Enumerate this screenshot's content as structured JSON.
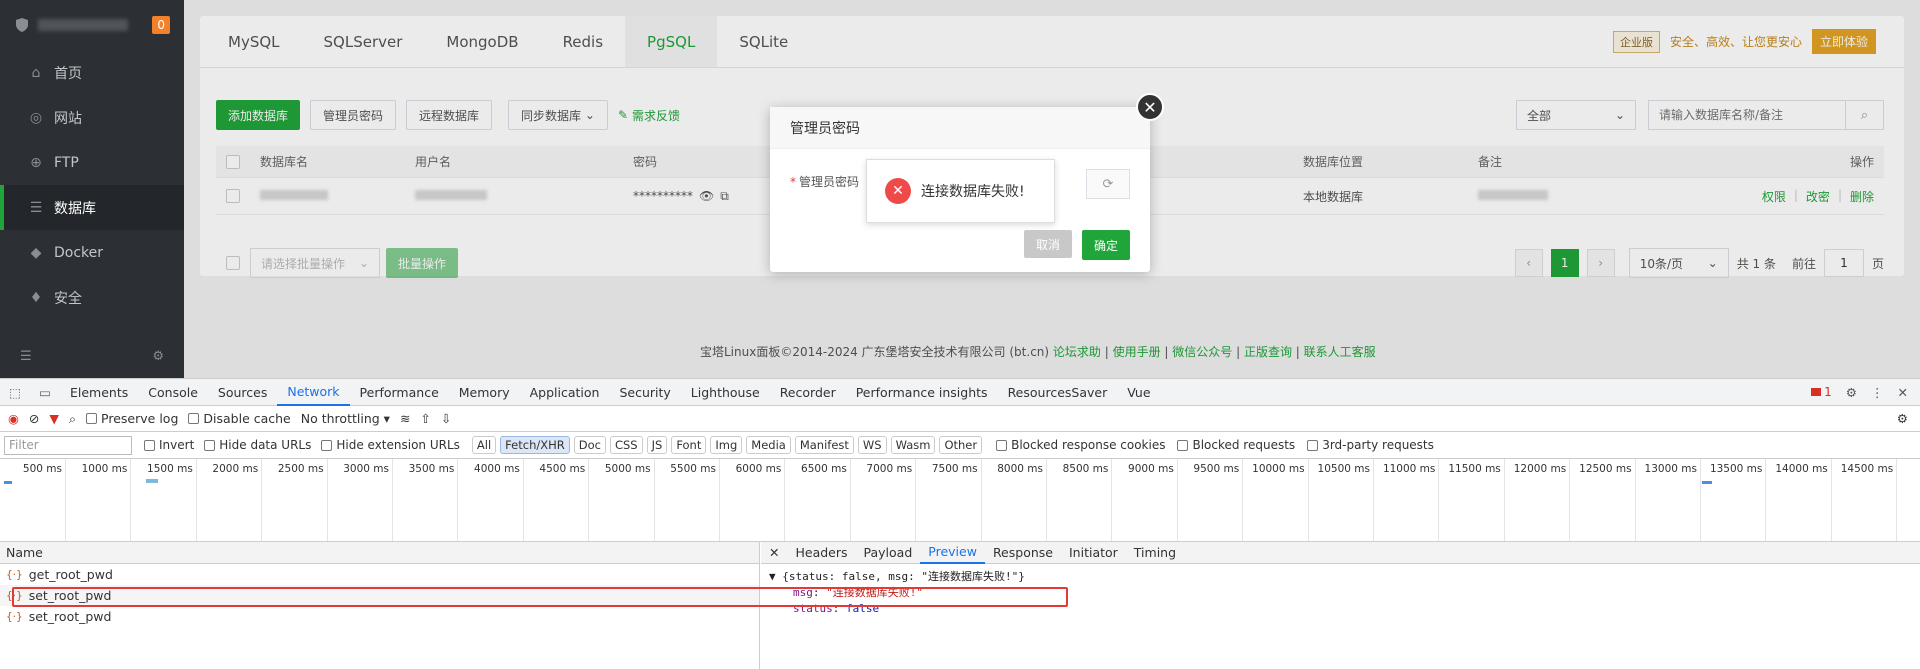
{
  "sidebar": {
    "badge": "0",
    "items": [
      {
        "label": "首页",
        "icon": "home-icon"
      },
      {
        "label": "网站",
        "icon": "globe-icon"
      },
      {
        "label": "FTP",
        "icon": "ftp-icon"
      },
      {
        "label": "数据库",
        "icon": "database-icon"
      },
      {
        "label": "Docker",
        "icon": "docker-icon"
      },
      {
        "label": "安全",
        "icon": "shield-icon"
      }
    ],
    "active_index": 3
  },
  "db_tabs": [
    "MySQL",
    "SQLServer",
    "MongoDB",
    "Redis",
    "PgSQL",
    "SQLite"
  ],
  "db_tabs_active": 4,
  "promo": {
    "tag": "企业版",
    "text": "安全、高效、让您更安心",
    "button": "立即体验"
  },
  "toolbar": {
    "add": "添加数据库",
    "admin_pwd": "管理员密码",
    "remote": "远程数据库",
    "sync": "同步数据库",
    "feedback": "需求反馈"
  },
  "filter": {
    "select": "全部",
    "placeholder": "请输入数据库名称/备注"
  },
  "table": {
    "headers": [
      "数据库名",
      "用户名",
      "密码",
      "数据库位置",
      "备注",
      "操作"
    ],
    "row": {
      "password": "**********",
      "location": "本地数据库",
      "actions": [
        "权限",
        "改密",
        "删除"
      ]
    }
  },
  "batch": {
    "placeholder": "请选择批量操作",
    "button": "批量操作"
  },
  "pager": {
    "current": "1",
    "page_size": "10条/页",
    "total": "共 1 条",
    "goto_label": "前往",
    "goto_value": "1",
    "goto_suffix": "页"
  },
  "footer": {
    "copyright": "宝塔Linux面板©2014-2024 广东堡塔安全技术有限公司 (bt.cn)",
    "links": [
      "论坛求助",
      "使用手册",
      "微信公众号",
      "正版查询",
      "联系人工客服"
    ]
  },
  "modal": {
    "title": "管理员密码",
    "label": "管理员密码",
    "cancel": "取消",
    "confirm": "确定"
  },
  "toast": {
    "message": "连接数据库失败!"
  },
  "devtools": {
    "tabs": [
      "Elements",
      "Console",
      "Sources",
      "Network",
      "Performance",
      "Memory",
      "Application",
      "Security",
      "Lighthouse",
      "Recorder",
      "Performance insights",
      "ResourcesSaver",
      "Vue"
    ],
    "active_tab": "Network",
    "error_count": "1",
    "toolbar": {
      "preserve_log": "Preserve log",
      "disable_cache": "Disable cache",
      "throttling": "No throttling"
    },
    "filter_placeholder": "Filter",
    "filter_options": [
      "Invert",
      "Hide data URLs",
      "Hide extension URLs"
    ],
    "type_pills": [
      "All",
      "Fetch/XHR",
      "Doc",
      "CSS",
      "JS",
      "Font",
      "Img",
      "Media",
      "Manifest",
      "WS",
      "Wasm",
      "Other"
    ],
    "type_active": "Fetch/XHR",
    "extra_filters": [
      "Blocked response cookies",
      "Blocked requests",
      "3rd-party requests"
    ],
    "timeline_ticks": [
      "500 ms",
      "1000 ms",
      "1500 ms",
      "2000 ms",
      "2500 ms",
      "3000 ms",
      "3500 ms",
      "4000 ms",
      "4500 ms",
      "5000 ms",
      "5500 ms",
      "6000 ms",
      "6500 ms",
      "7000 ms",
      "7500 ms",
      "8000 ms",
      "8500 ms",
      "9000 ms",
      "9500 ms",
      "10000 ms",
      "10500 ms",
      "11000 ms",
      "11500 ms",
      "12000 ms",
      "12500 ms",
      "13000 ms",
      "13500 ms",
      "14000 ms",
      "14500 ms"
    ],
    "name_header": "Name",
    "requests": [
      "get_root_pwd",
      "set_root_pwd",
      "set_root_pwd"
    ],
    "detail_tabs": [
      "Headers",
      "Payload",
      "Preview",
      "Response",
      "Initiator",
      "Timing"
    ],
    "detail_active": "Preview",
    "preview": {
      "summary": "{status: false, msg: \"连接数据库失败!\"}",
      "msg_key": "msg",
      "msg_value": "\"连接数据库失败!\"",
      "status_key": "status",
      "status_value": "false"
    }
  }
}
